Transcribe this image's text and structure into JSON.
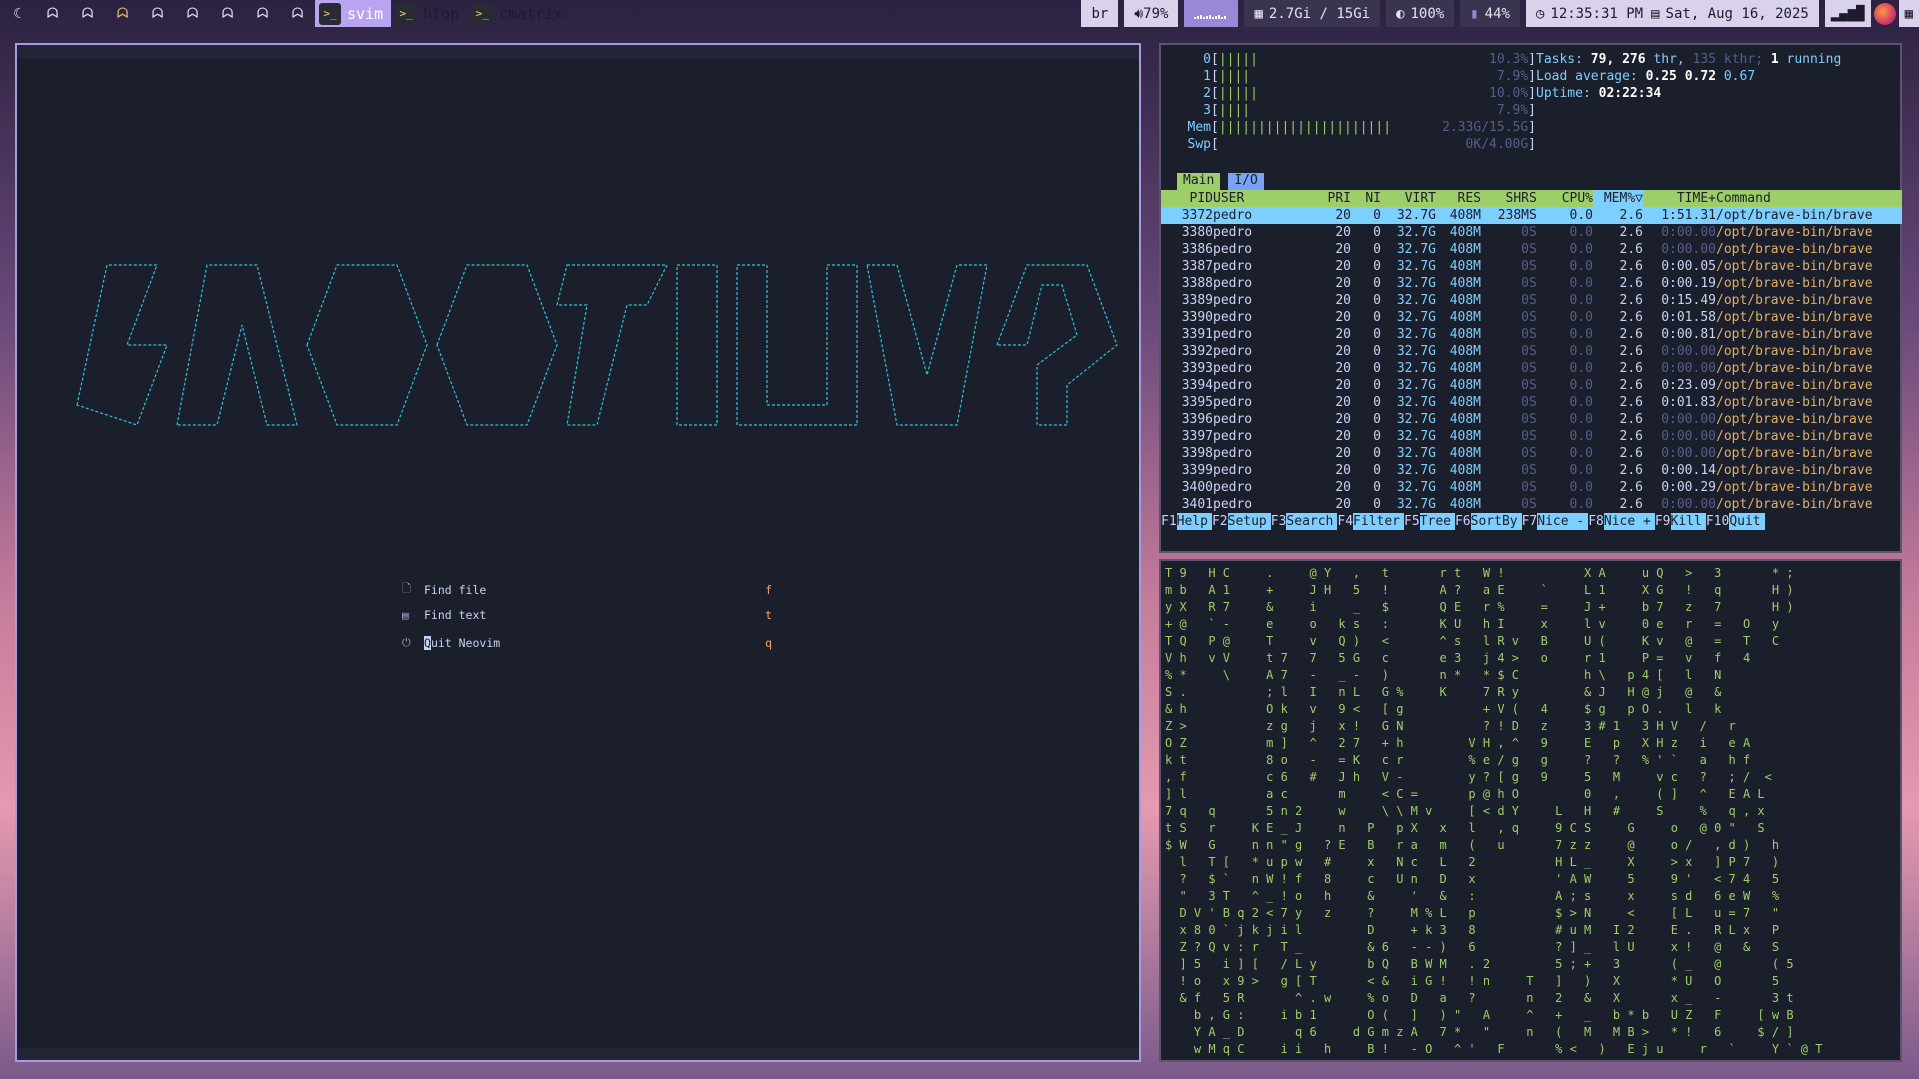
{
  "bar": {
    "workspaces": [
      "☾",
      "ᗣ",
      "ᗣ",
      "ᗣ",
      "ᗣ",
      "ᗣ",
      "ᗣ",
      "ᗣ",
      "ᗣ"
    ],
    "apps": [
      {
        "label": "svim",
        "active": true
      },
      {
        "label": "htop",
        "active": false
      },
      {
        "label": "cmatrix",
        "active": false
      }
    ],
    "keyboard": "br",
    "volume": "79%",
    "memory": "2.7Gi / 15Gi",
    "brightness": "100%",
    "battery": "44%",
    "time": "12:35:31 PM",
    "date": "Sat, Aug 16, 2025"
  },
  "nvim": {
    "dashboard": [
      {
        "icon": "file-icon",
        "label": "Find file",
        "key": "f"
      },
      {
        "icon": "text-icon",
        "label": "Find text",
        "key": "t"
      },
      {
        "icon": "power-icon",
        "label": "Quit Neovim",
        "label_first": "Q",
        "label_rest": "uit Neovim",
        "key": "q"
      }
    ]
  },
  "htop": {
    "cpus": [
      {
        "id": "0",
        "bars": "|||||",
        "value": "10.3%"
      },
      {
        "id": "1",
        "bars": "||||",
        "value": "7.9%"
      },
      {
        "id": "2",
        "bars": "|||||",
        "value": "10.0%"
      },
      {
        "id": "3",
        "bars": "||||",
        "value": "7.9%"
      }
    ],
    "mem": {
      "label": "Mem",
      "bars": "||||||||||||||||||||||",
      "value": "2.33G/15.5G"
    },
    "swp": {
      "label": "Swp",
      "bars": "",
      "value": "0K/4.00G"
    },
    "tasks_label": "Tasks:",
    "tasks": "79,",
    "threads": "276",
    "thr": "thr,",
    "kthr": "135 kthr;",
    "running": "1",
    "running_label": "running",
    "load_label": "Load average:",
    "load1": "0.25",
    "load5": "0.72",
    "load15": "0.67",
    "uptime_label": "Uptime:",
    "uptime": "02:22:34",
    "tabs": [
      "Main",
      "I/O"
    ],
    "columns": [
      "PID",
      "USER",
      "PRI",
      "NI",
      "VIRT",
      "RES",
      "SHR",
      "S",
      "CPU%",
      "MEM%▽",
      "TIME+",
      "Command"
    ],
    "processes": [
      {
        "pid": "3372",
        "user": "pedro",
        "pri": "20",
        "ni": "0",
        "virt": "32.7G",
        "res": "408M",
        "shr": "238M",
        "s": "S",
        "cpu": "0.0",
        "mem": "2.6",
        "time": "1:51.31",
        "cmd": "/opt/brave-bin/brave"
      },
      {
        "pid": "3380",
        "user": "pedro",
        "pri": "20",
        "ni": "0",
        "virt": "32.7G",
        "res": "408M",
        "shr": "0",
        "s": "S",
        "cpu": "0.0",
        "mem": "2.6",
        "time": "0:00.00",
        "cmd": "/opt/brave-bin/brave"
      },
      {
        "pid": "3386",
        "user": "pedro",
        "pri": "20",
        "ni": "0",
        "virt": "32.7G",
        "res": "408M",
        "shr": "0",
        "s": "S",
        "cpu": "0.0",
        "mem": "2.6",
        "time": "0:00.00",
        "cmd": "/opt/brave-bin/brave"
      },
      {
        "pid": "3387",
        "user": "pedro",
        "pri": "20",
        "ni": "0",
        "virt": "32.7G",
        "res": "408M",
        "shr": "0",
        "s": "S",
        "cpu": "0.0",
        "mem": "2.6",
        "time": "0:00.05",
        "cmd": "/opt/brave-bin/brave"
      },
      {
        "pid": "3388",
        "user": "pedro",
        "pri": "20",
        "ni": "0",
        "virt": "32.7G",
        "res": "408M",
        "shr": "0",
        "s": "S",
        "cpu": "0.0",
        "mem": "2.6",
        "time": "0:00.19",
        "cmd": "/opt/brave-bin/brave"
      },
      {
        "pid": "3389",
        "user": "pedro",
        "pri": "20",
        "ni": "0",
        "virt": "32.7G",
        "res": "408M",
        "shr": "0",
        "s": "S",
        "cpu": "0.0",
        "mem": "2.6",
        "time": "0:15.49",
        "cmd": "/opt/brave-bin/brave"
      },
      {
        "pid": "3390",
        "user": "pedro",
        "pri": "20",
        "ni": "0",
        "virt": "32.7G",
        "res": "408M",
        "shr": "0",
        "s": "S",
        "cpu": "0.0",
        "mem": "2.6",
        "time": "0:01.58",
        "cmd": "/opt/brave-bin/brave"
      },
      {
        "pid": "3391",
        "user": "pedro",
        "pri": "20",
        "ni": "0",
        "virt": "32.7G",
        "res": "408M",
        "shr": "0",
        "s": "S",
        "cpu": "0.0",
        "mem": "2.6",
        "time": "0:00.81",
        "cmd": "/opt/brave-bin/brave"
      },
      {
        "pid": "3392",
        "user": "pedro",
        "pri": "20",
        "ni": "0",
        "virt": "32.7G",
        "res": "408M",
        "shr": "0",
        "s": "S",
        "cpu": "0.0",
        "mem": "2.6",
        "time": "0:00.00",
        "cmd": "/opt/brave-bin/brave"
      },
      {
        "pid": "3393",
        "user": "pedro",
        "pri": "20",
        "ni": "0",
        "virt": "32.7G",
        "res": "408M",
        "shr": "0",
        "s": "S",
        "cpu": "0.0",
        "mem": "2.6",
        "time": "0:00.00",
        "cmd": "/opt/brave-bin/brave"
      },
      {
        "pid": "3394",
        "user": "pedro",
        "pri": "20",
        "ni": "0",
        "virt": "32.7G",
        "res": "408M",
        "shr": "0",
        "s": "S",
        "cpu": "0.0",
        "mem": "2.6",
        "time": "0:23.09",
        "cmd": "/opt/brave-bin/brave"
      },
      {
        "pid": "3395",
        "user": "pedro",
        "pri": "20",
        "ni": "0",
        "virt": "32.7G",
        "res": "408M",
        "shr": "0",
        "s": "S",
        "cpu": "0.0",
        "mem": "2.6",
        "time": "0:01.83",
        "cmd": "/opt/brave-bin/brave"
      },
      {
        "pid": "3396",
        "user": "pedro",
        "pri": "20",
        "ni": "0",
        "virt": "32.7G",
        "res": "408M",
        "shr": "0",
        "s": "S",
        "cpu": "0.0",
        "mem": "2.6",
        "time": "0:00.00",
        "cmd": "/opt/brave-bin/brave"
      },
      {
        "pid": "3397",
        "user": "pedro",
        "pri": "20",
        "ni": "0",
        "virt": "32.7G",
        "res": "408M",
        "shr": "0",
        "s": "S",
        "cpu": "0.0",
        "mem": "2.6",
        "time": "0:00.00",
        "cmd": "/opt/brave-bin/brave"
      },
      {
        "pid": "3398",
        "user": "pedro",
        "pri": "20",
        "ni": "0",
        "virt": "32.7G",
        "res": "408M",
        "shr": "0",
        "s": "S",
        "cpu": "0.0",
        "mem": "2.6",
        "time": "0:00.00",
        "cmd": "/opt/brave-bin/brave"
      },
      {
        "pid": "3399",
        "user": "pedro",
        "pri": "20",
        "ni": "0",
        "virt": "32.7G",
        "res": "408M",
        "shr": "0",
        "s": "S",
        "cpu": "0.0",
        "mem": "2.6",
        "time": "0:00.14",
        "cmd": "/opt/brave-bin/brave"
      },
      {
        "pid": "3400",
        "user": "pedro",
        "pri": "20",
        "ni": "0",
        "virt": "32.7G",
        "res": "408M",
        "shr": "0",
        "s": "S",
        "cpu": "0.0",
        "mem": "2.6",
        "time": "0:00.29",
        "cmd": "/opt/brave-bin/brave"
      },
      {
        "pid": "3401",
        "user": "pedro",
        "pri": "20",
        "ni": "0",
        "virt": "32.7G",
        "res": "408M",
        "shr": "0",
        "s": "S",
        "cpu": "0.0",
        "mem": "2.6",
        "time": "0:00.00",
        "cmd": "/opt/brave-bin/brave"
      }
    ],
    "fkeys": [
      {
        "key": "F1",
        "label": "Help"
      },
      {
        "key": "F2",
        "label": "Setup"
      },
      {
        "key": "F3",
        "label": "Search"
      },
      {
        "key": "F4",
        "label": "Filter"
      },
      {
        "key": "F5",
        "label": "Tree"
      },
      {
        "key": "F6",
        "label": "SortBy"
      },
      {
        "key": "F7",
        "label": "Nice -"
      },
      {
        "key": "F8",
        "label": "Nice +"
      },
      {
        "key": "F9",
        "label": "Kill"
      },
      {
        "key": "F10",
        "label": "Quit"
      }
    ]
  },
  "matrix": {
    "rows": [
      "T 9   H C     .     @ Y   ,   t       r t   W !           X A     u Q   >   3       * ;",
      "m b   A 1     +     J H   5   !       A ?   a E     `     L 1     X G   !   q       H )",
      "y X   R 7     &     i     _   $       Q E   r %     =     J +     b 7   z   7       H )",
      "+ @   ` -     e     o   k s   :       K U   h I     x     l v     0 e   r   =   O   y",
      "T Q   P @     T     v   Q )   <       ^ s   l R v   B     U (     K v   @   =   T   C",
      "V h   v V     t 7   7   5 G   c       e 3   j 4 >   o     r 1     P =   v   f   4",
      "% *     \\     A 7   -   _ -   )       n *   * $ C         h \\   p 4 [   l   N",
      "S .           ; l   I   n L   G %     K     7 R y         & J   H @ j   @   &",
      "& h           O k   v   9 <   [ g           + V (   4     $ g   p O .   l   k",
      "Z >           z g   j   x !   G N           ? ! D   z     3 # 1   3 H V   /   r",
      "O Z           m ]   ^   2 7   + h         V H , ^   9     E   p   X H z   i   e A",
      "k t           8 o   -   = K   c r         % e / g   g     ?   ?   % ' `   a   h f",
      ", f           c 6   #   J h   V -         y ? [ g   9     5   M     v c   ?   ; /  <",
      "] l           a c       m     < C =       p @ h O         0   ,     ( ]   ^   E A L",
      "7 q   q       5 n 2     w     \\ \\ M v     [ < d Y     L   H   #     S     %   q , x",
      "t S   r     K E _ J     n   P   p X   x   l   , q     9 C S     G     o   @ 0 \"   S",
      "$ W   G     n n \" g   ? E   B   r a   m   (   u       7 z z     @     o /   , d )   h",
      "  l   T [   * u p w   #     x   N c   L   2           H L _     X     > x   ] P 7   )",
      "  ?   $ `   n W ! f   8     c   U n   D   x           ' A W     5     9 '   < 7 4   5",
      "  \"   3 T   ^ _ ! o   h     &     '   &   :           A ; s     x     s d   6 e W   %",
      "  D V ' B q 2 < 7 y   z     ?     M % L   p           $ > N     <     [ L   u = 7   \"",
      "  x 8 0 ` j k j i l         D     + k 3   8           # u M   I 2     E .   R L x   P",
      "  Z ? Q v : r   T _         & 6   - - )   6           ? ] _   l U     x !   @   &   S",
      "  ] 5   i ] [   / L y       b Q   B W M   . 2         5 ; +   3       ( _   @       ( 5",
      "  ! o   x 9 >   g [ T       < &   i G !   ! n     T   ]   )   X       * U   O       5",
      "  & f   5 R       ^ . w     % o   D   a   ?       n   2   &   X       x _   -       3 t",
      "    b , G :     i b 1       O (   ]   ) \"   A     ^   +   _   b * b   U Z   F     [ w B",
      "    Y A _ D       q 6     d G m z A   7 *   \"     n   (   M   M B >   * !   6     $ / ]",
      "    w M q C     i i   h     B !   - O   ^ '   F       % <   )   E j u     r   `     Y ` @ T"
    ]
  }
}
